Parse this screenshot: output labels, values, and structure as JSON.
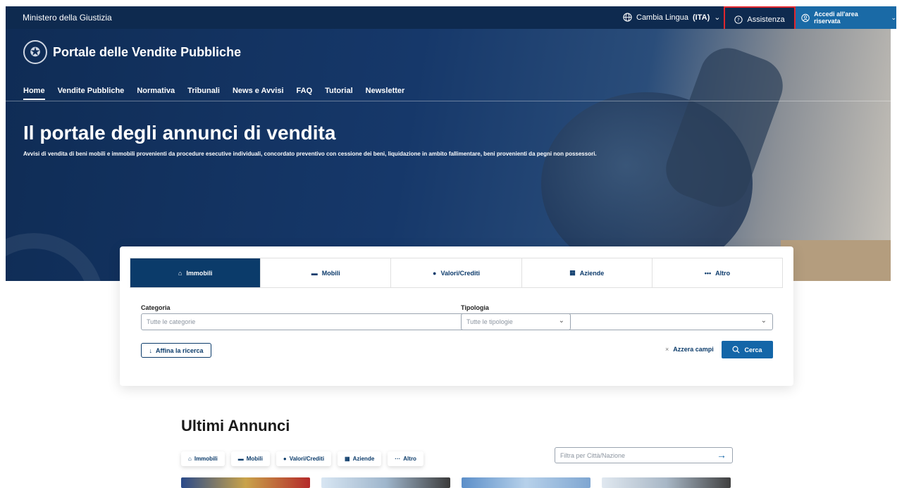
{
  "topbar": {
    "ministry": "Ministero della Giustizia",
    "lang_label": "Cambia Lingua",
    "lang_code": "(ITA)",
    "assist_label": "Assistenza",
    "login_label": "Accedi all'area riservata"
  },
  "header": {
    "portal_title": "Portale delle Vendite Pubbliche",
    "nav": [
      "Home",
      "Vendite Pubbliche",
      "Normativa",
      "Tribunali",
      "News e Avvisi",
      "FAQ",
      "Tutorial",
      "Newsletter"
    ]
  },
  "hero": {
    "title": "Il portale degli annunci di vendita",
    "subtitle": "Avvisi di vendita di beni mobili e immobili provenienti da procedure esecutive individuali, concordato preventivo con cessione dei beni, liquidazione in ambito fallimentare, beni provenienti da pegni non possessori."
  },
  "search": {
    "tabs": [
      {
        "label": "Immobili",
        "icon": "home-icon"
      },
      {
        "label": "Mobili",
        "icon": "car-icon"
      },
      {
        "label": "Valori/Crediti",
        "icon": "coin-icon"
      },
      {
        "label": "Aziende",
        "icon": "building-icon"
      },
      {
        "label": "Altro",
        "icon": "more-icon"
      }
    ],
    "categoria_label": "Categoria",
    "categoria_placeholder": "Tutte le categorie",
    "tipologia_label": "Tipologia",
    "tipologia_placeholder": "Tutte le tipologie",
    "refine_label": "Affina la ricerca",
    "reset_label": "Azzera campi",
    "search_label": "Cerca"
  },
  "annunci": {
    "title": "Ultimi Annunci",
    "pills": [
      "Immobili",
      "Mobili",
      "Valori/Crediti",
      "Aziende",
      "Altro"
    ],
    "filter_placeholder": "Filtra per Città/Nazione"
  }
}
